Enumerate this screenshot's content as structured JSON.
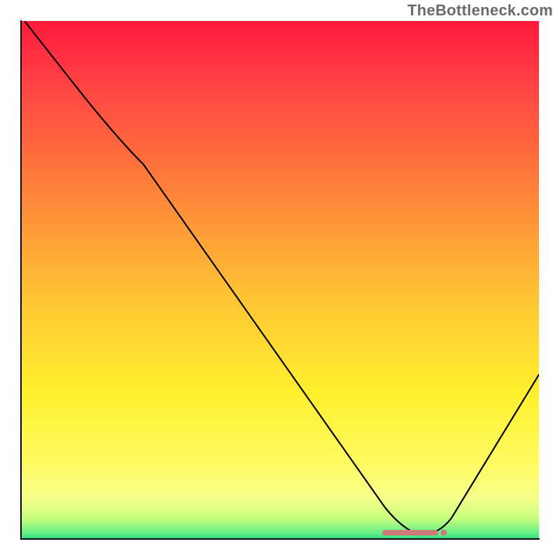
{
  "watermark": "TheBottleneck.com",
  "colors": {
    "gradient_top": "#ff1a3a",
    "gradient_mid": "#fff02e",
    "gradient_bottom": "#2cd97d",
    "curve": "#000000",
    "marker": "#cb7b78"
  },
  "chart_data": {
    "type": "line",
    "title": "",
    "xlabel": "",
    "ylabel": "",
    "xlim": [
      0,
      100
    ],
    "ylim": [
      0,
      100
    ],
    "x": [
      0,
      5,
      10,
      15,
      20,
      25,
      30,
      35,
      40,
      45,
      50,
      55,
      60,
      65,
      70,
      72,
      75,
      78,
      80,
      85,
      90,
      95,
      100
    ],
    "values": [
      100,
      95,
      88,
      82,
      77,
      74,
      67,
      59,
      52,
      44,
      37,
      29,
      22,
      14,
      6,
      3,
      1,
      0.5,
      1,
      6,
      14,
      23,
      32
    ],
    "optimum_x": 77,
    "optimum_marker": {
      "x_start": 70,
      "x_end": 81,
      "y": 1.2
    }
  }
}
